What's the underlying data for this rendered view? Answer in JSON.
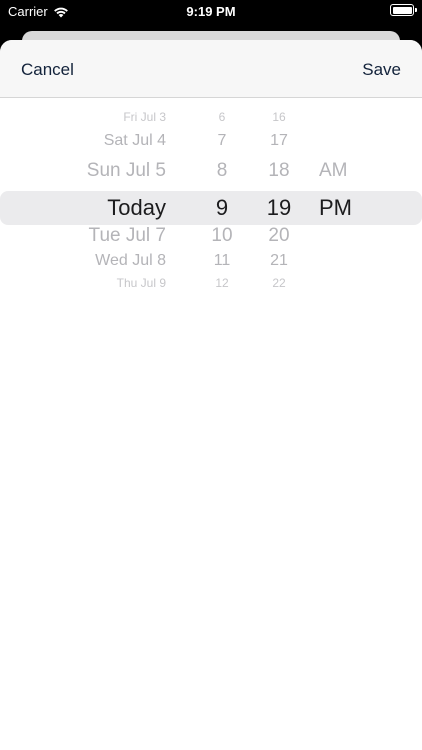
{
  "status_bar": {
    "carrier": "Carrier",
    "time": "9:19 PM"
  },
  "nav": {
    "cancel_label": "Cancel",
    "save_label": "Save"
  },
  "picker": {
    "days": [
      "Fri Jul 3",
      "Sat Jul 4",
      "Sun Jul 5",
      "Today",
      "Tue Jul 7",
      "Wed Jul 8",
      "Thu Jul 9"
    ],
    "hours": [
      "6",
      "7",
      "8",
      "9",
      "10",
      "11",
      "12"
    ],
    "minutes": [
      "16",
      "17",
      "18",
      "19",
      "20",
      "21",
      "22"
    ],
    "ampm": [
      "AM",
      "PM"
    ],
    "selected": {
      "day": "Today",
      "hour": "9",
      "minute": "19",
      "period": "PM"
    }
  }
}
